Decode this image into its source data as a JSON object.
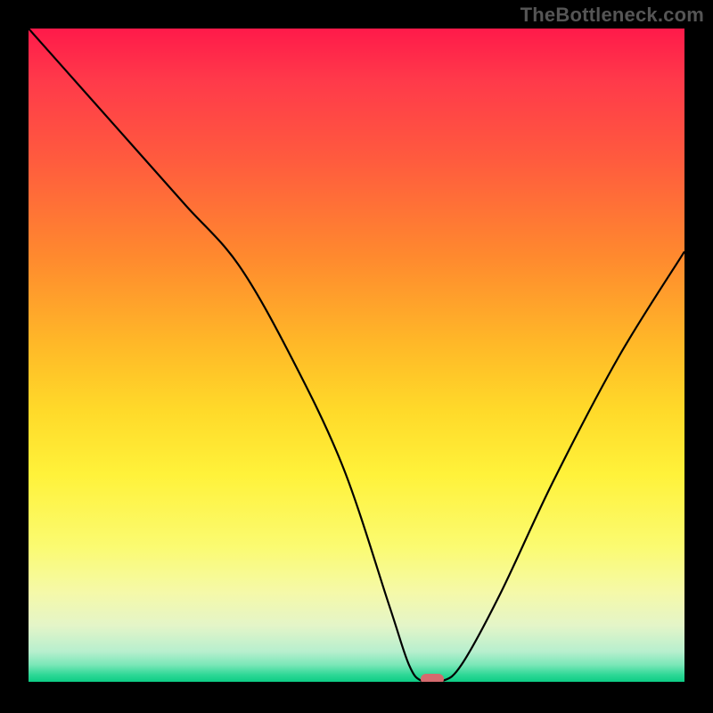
{
  "watermark": "TheBottleneck.com",
  "chart_data": {
    "type": "line",
    "title": "",
    "xlabel": "",
    "ylabel": "",
    "xlim": [
      0,
      100
    ],
    "ylim": [
      0,
      100
    ],
    "x": [
      0,
      8,
      16,
      24,
      32,
      40,
      48,
      55,
      58,
      60,
      63,
      66,
      72,
      80,
      90,
      100
    ],
    "values": [
      100,
      91,
      82,
      73,
      64,
      50,
      33,
      12,
      3,
      0.5,
      0.5,
      3,
      14,
      31,
      50,
      66
    ],
    "marker": {
      "x": 61.5,
      "y": 0.8
    },
    "gradient_scale": "bottleneck-severity"
  }
}
